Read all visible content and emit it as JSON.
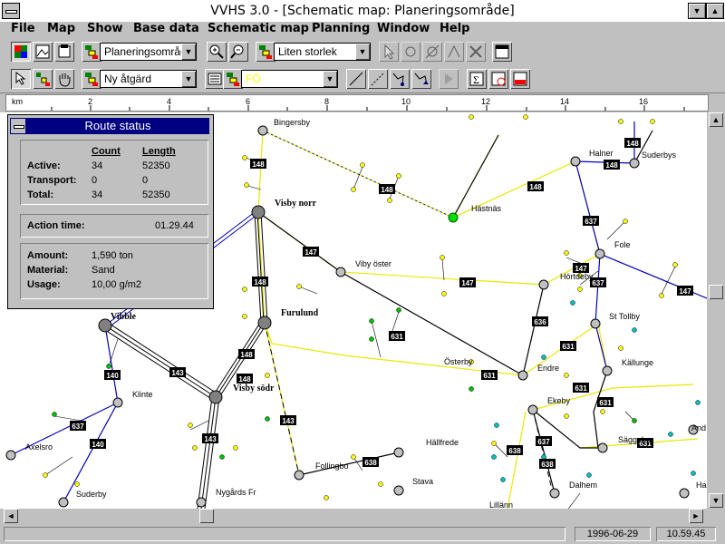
{
  "window": {
    "title": "VVHS 3.0 - [Schematic map: Planeringsområde]"
  },
  "menu": [
    {
      "label": "File",
      "ul": "F"
    },
    {
      "label": "Map",
      "ul": "M"
    },
    {
      "label": "Show",
      "ul": "S"
    },
    {
      "label": "Base data",
      "ul": "B"
    },
    {
      "label": "Schematic map",
      "ul": "S"
    },
    {
      "label": "Planning",
      "ul": "P"
    },
    {
      "label": "Window",
      "ul": "W"
    },
    {
      "label": "Help",
      "ul": "H"
    }
  ],
  "toolbar1": {
    "area_combo": "Planeringsområde",
    "size_combo": "Liten storlek"
  },
  "toolbar2": {
    "action_combo": "Ny åtgärd",
    "field_combo": "FÖ"
  },
  "ruler": {
    "unit": "km",
    "ticks": [
      "2",
      "4",
      "6",
      "8",
      "10",
      "12",
      "14",
      "16"
    ]
  },
  "panel": {
    "title": "Route status",
    "headers": {
      "count": "Count",
      "length": "Length"
    },
    "rows": [
      {
        "label": "Active:",
        "count": "34",
        "length": "52350"
      },
      {
        "label": "Transport:",
        "count": "0",
        "length": "0"
      },
      {
        "label": "Total:",
        "count": "34",
        "length": "52350"
      }
    ],
    "action_time_label": "Action time:",
    "action_time": "01.29.44",
    "amount_label": "Amount:",
    "amount": "1,590 ton",
    "material_label": "Material:",
    "material": "Sand",
    "usage_label": "Usage:",
    "usage": "10,00 g/m2"
  },
  "map": {
    "places": [
      {
        "name": "Bingersby",
        "bold": false
      },
      {
        "name": "Visby norr",
        "bold": true
      },
      {
        "name": "Vibble",
        "bold": true
      },
      {
        "name": "Furulund",
        "bold": true
      },
      {
        "name": "Visby södr",
        "bold": true
      },
      {
        "name": "Hästnäs",
        "bold": false
      },
      {
        "name": "Halner",
        "bold": false
      },
      {
        "name": "Suderbys",
        "bold": false
      },
      {
        "name": "Fole",
        "bold": false
      },
      {
        "name": "Viby öster",
        "bold": false
      },
      {
        "name": "Hörtdeby",
        "bold": false
      },
      {
        "name": "St Tollby",
        "bold": false
      },
      {
        "name": "Österby",
        "bold": false
      },
      {
        "name": "Endre",
        "bold": false
      },
      {
        "name": "Källunge",
        "bold": false
      },
      {
        "name": "Klinte",
        "bold": false
      },
      {
        "name": "Axelsro",
        "bold": false
      },
      {
        "name": "Suderby",
        "bold": false
      },
      {
        "name": "Ekeby",
        "bold": false
      },
      {
        "name": "Hällfrede",
        "bold": false
      },
      {
        "name": "Follingbo",
        "bold": false
      },
      {
        "name": "Stava",
        "bold": false
      },
      {
        "name": "Nygårds Fr",
        "bold": false
      },
      {
        "name": "Säggebu",
        "bold": false
      },
      {
        "name": "Dalhem",
        "bold": false
      },
      {
        "name": "Lillänn",
        "bold": false
      },
      {
        "name": "And",
        "bold": false
      },
      {
        "name": "Ha",
        "bold": false
      }
    ],
    "route_tags": [
      "148",
      "148",
      "148",
      "148",
      "148",
      "148",
      "147",
      "147",
      "147",
      "148",
      "148",
      "143",
      "143",
      "140",
      "140",
      "637",
      "637",
      "637",
      "637",
      "631",
      "631",
      "631",
      "631",
      "631",
      "636",
      "638",
      "638",
      "638",
      "631",
      "143",
      "147"
    ]
  },
  "status": {
    "date": "1996-06-29",
    "time": "10.59.45"
  }
}
